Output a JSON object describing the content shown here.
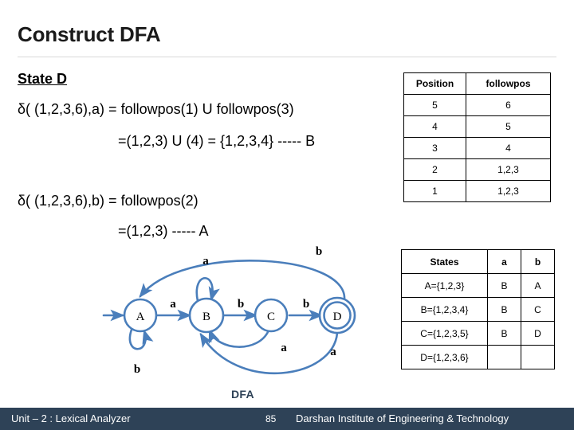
{
  "header": {
    "title": "Construct DFA"
  },
  "derivation": {
    "heading": "State D",
    "lines": [
      "δ( (1,2,3,6),a) = followpos(1) U followpos(3)",
      "=(1,2,3) U (4) = {1,2,3,4} ----- B",
      "δ( (1,2,3,6),b) = followpos(2)",
      "=(1,2,3)  ----- A"
    ]
  },
  "followpos_table": {
    "headers": [
      "Position",
      "followpos"
    ],
    "rows": [
      [
        "5",
        "6"
      ],
      [
        "4",
        "5"
      ],
      [
        "3",
        "4"
      ],
      [
        "2",
        "1,2,3"
      ],
      [
        "1",
        "1,2,3"
      ]
    ]
  },
  "transition_table": {
    "headers": [
      "States",
      "a",
      "b"
    ],
    "rows": [
      [
        "A={1,2,3}",
        "B",
        "A"
      ],
      [
        "B={1,2,3,4}",
        "B",
        "C"
      ],
      [
        "C={1,2,3,5}",
        "B",
        "D"
      ],
      [
        "D={1,2,3,6}",
        "",
        ""
      ]
    ]
  },
  "dfa": {
    "caption": "DFA",
    "stroke_color": "#4a7ebb",
    "states": [
      {
        "id": "A",
        "label": "A",
        "accepting": false,
        "start": true
      },
      {
        "id": "B",
        "label": "B",
        "accepting": false,
        "start": false
      },
      {
        "id": "C",
        "label": "C",
        "accepting": false,
        "start": false
      },
      {
        "id": "D",
        "label": "D",
        "accepting": true,
        "start": false
      }
    ],
    "transitions": [
      {
        "from": "A",
        "to": "B",
        "label": "a"
      },
      {
        "from": "A",
        "to": "A",
        "label": "b"
      },
      {
        "from": "B",
        "to": "B",
        "label": "a"
      },
      {
        "from": "B",
        "to": "C",
        "label": "b"
      },
      {
        "from": "C",
        "to": "B",
        "label": "a"
      },
      {
        "from": "C",
        "to": "D",
        "label": "b"
      },
      {
        "from": "D",
        "to": "B",
        "label": "a"
      },
      {
        "from": "D",
        "to": "A",
        "label": "b"
      }
    ],
    "edge_labels": {
      "a_to_b": "a",
      "a_self": "b",
      "b_self": "a",
      "b_to_c": "b",
      "c_to_b": "a",
      "c_to_d": "b",
      "d_to_b": "a",
      "d_to_a": "b"
    }
  },
  "footer": {
    "unit": "Unit – 2 : Lexical Analyzer",
    "page": "85",
    "institute": "Darshan Institute of Engineering & Technology",
    "bar_color": "#2e4257"
  }
}
